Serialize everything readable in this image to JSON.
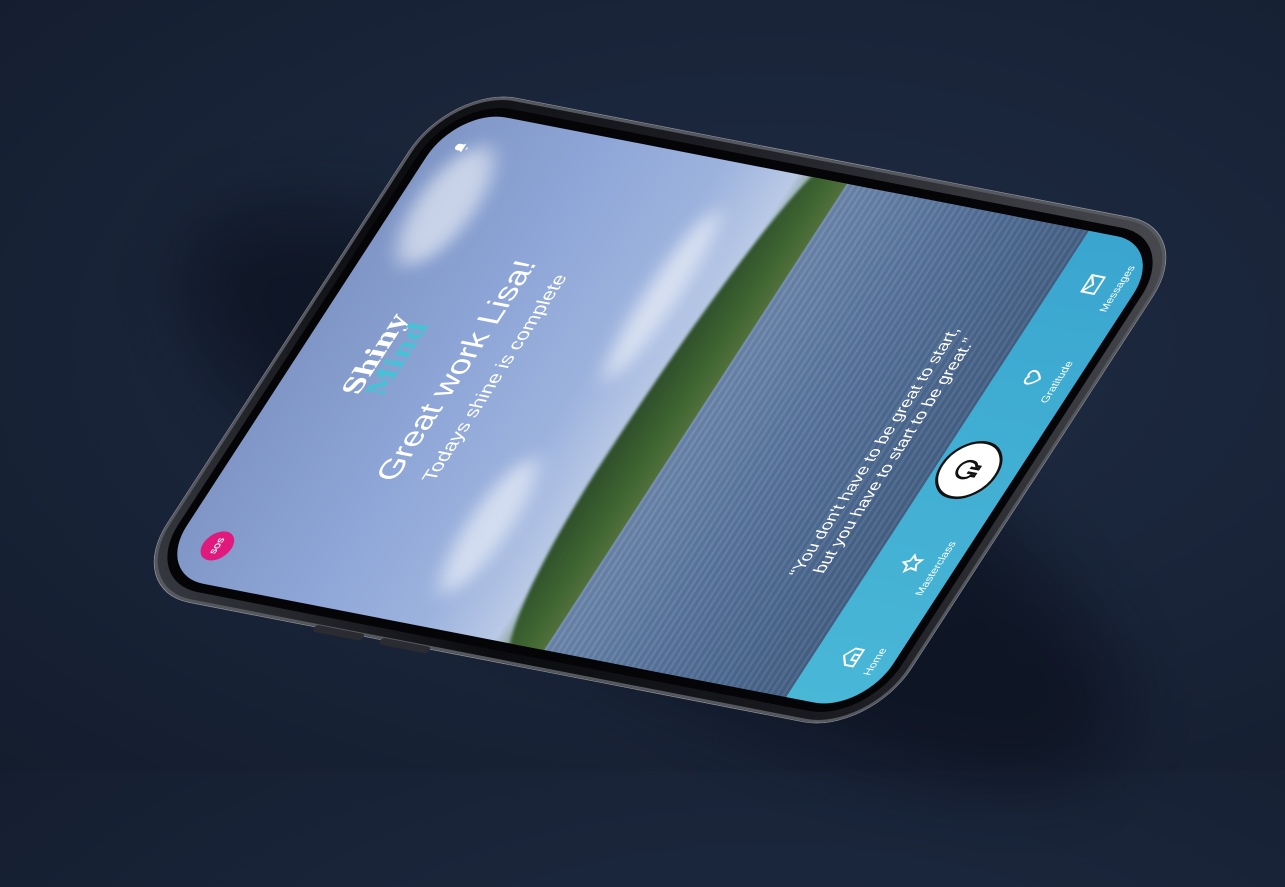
{
  "app": {
    "logo_line1": "Shiny",
    "logo_line2": "Mind",
    "sos_label": "SOS",
    "headline": "Great work Lisa!",
    "subline": "Todays shine is complete",
    "quote_line1": "“You don't have to be great to start,",
    "quote_line2": "but you have to start to be great.”"
  },
  "tabs": [
    {
      "label": "Home",
      "icon": "home-icon"
    },
    {
      "label": "Masterclass",
      "icon": "star-icon"
    },
    {
      "label": "",
      "icon": "shiny-mind-center-icon"
    },
    {
      "label": "Gratitude",
      "icon": "heart-icon"
    },
    {
      "label": "Messages",
      "icon": "envelope-icon"
    }
  ],
  "colors": {
    "background": "#1c273d",
    "tabbar": "#3fb0d4",
    "sos": "#e0197d",
    "logo_accent": "#48c1d6"
  }
}
